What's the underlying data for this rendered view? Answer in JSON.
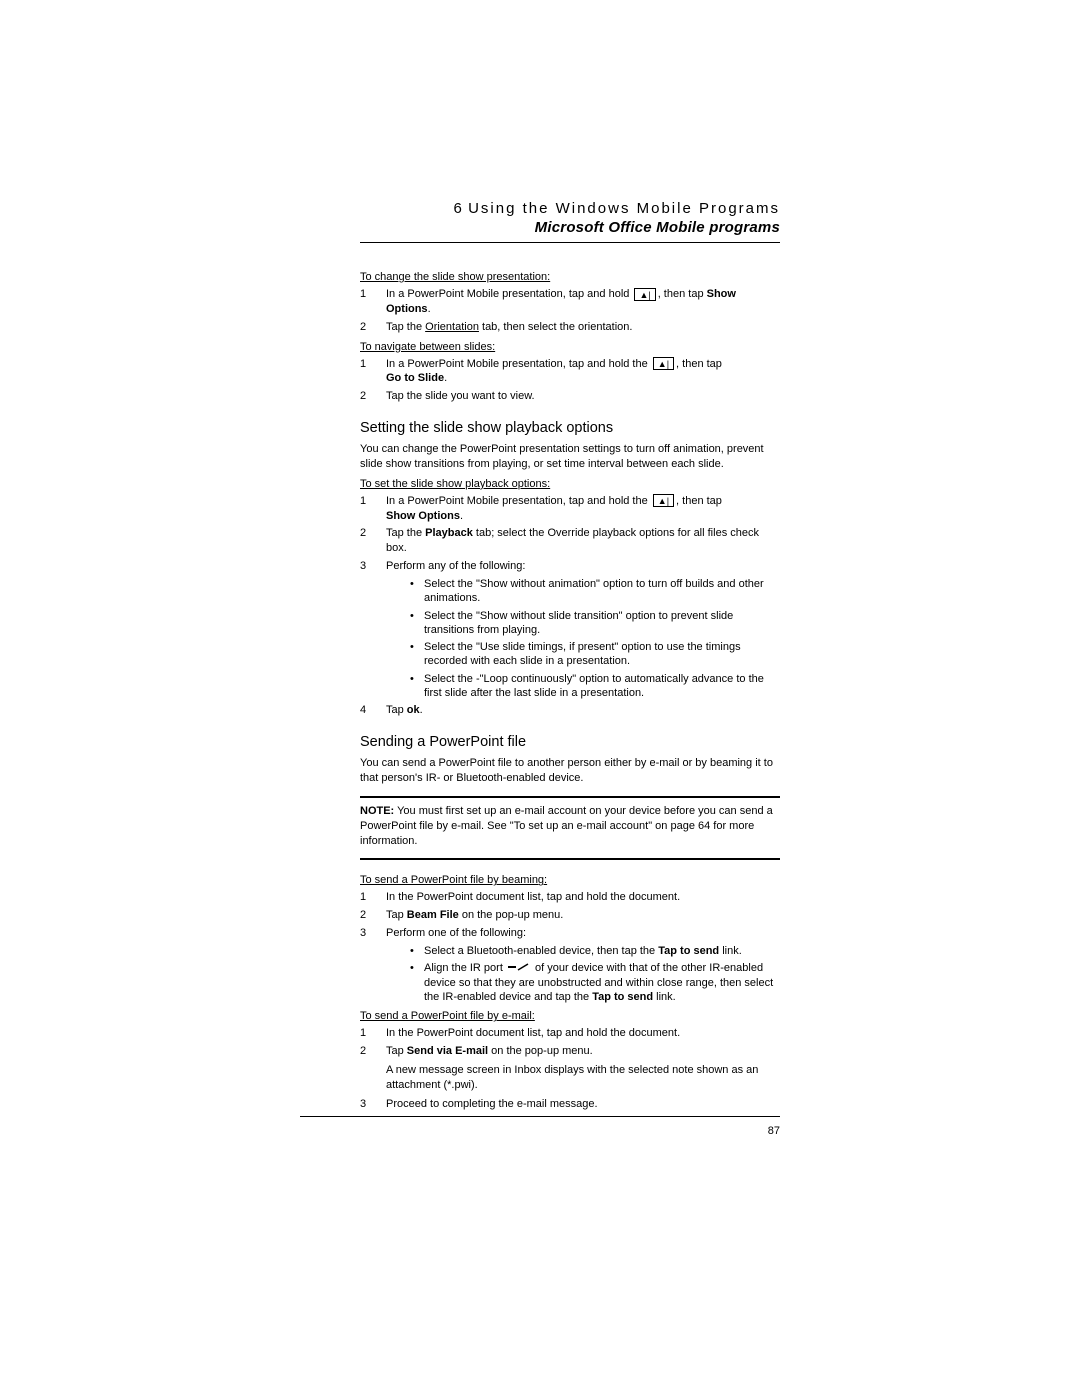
{
  "header": {
    "chapter_num": "6",
    "chapter_title": "Using the Windows Mobile Programs",
    "subtitle": "Microsoft Office Mobile programs"
  },
  "page_number": "87",
  "sec1": {
    "title": "To change the slide show presentation:",
    "step1_a": "In a PowerPoint Mobile presentation, tap and hold ",
    "step1_b": ", then tap ",
    "step1_bold": "Show Options",
    "step1_c": ".",
    "step2_a": "Tap the ",
    "step2_link": "Orientation",
    "step2_b": " tab, then select the orientation."
  },
  "sec2": {
    "title": "To navigate between slides:",
    "step1_a": "In a PowerPoint Mobile presentation, tap and hold the ",
    "step1_b": ", then tap ",
    "step1_bold": "Go to Slide",
    "step1_c": ".",
    "step2": "Tap the slide you want to view."
  },
  "sec3": {
    "heading": "Setting the slide show playback options",
    "intro": "You can change the PowerPoint presentation settings to turn off animation, prevent slide show transitions from playing, or set time interval between each slide.",
    "subtitle": "To set the slide show playback options:",
    "step1_a": "In a PowerPoint Mobile presentation, tap and hold the ",
    "step1_b": ", then tap ",
    "step1_bold": "Show Options",
    "step1_c": ".",
    "step2_a": "Tap the ",
    "step2_bold": "Playback",
    "step2_b": " tab; select the Override playback options for all files check box.",
    "step3": "Perform any of the following:",
    "b1": "Select the \"Show without animation\" option to turn off builds and other animations.",
    "b2": "Select the \"Show without slide transition\" option to prevent slide transitions from playing.",
    "b3": "Select the \"Use slide timings, if present\" option to use the timings recorded with each slide in a presentation.",
    "b4": "Select the -\"Loop continuously\" option to automatically advance to the first slide after the last slide in a presentation.",
    "step4_a": "Tap ",
    "step4_bold": "ok",
    "step4_b": "."
  },
  "sec4": {
    "heading": "Sending a PowerPoint file",
    "intro": "You can send a PowerPoint file to another person either by e-mail or by beaming it to that person's IR- or Bluetooth-enabled device.",
    "note_label": "NOTE:",
    "note_text": "   You must first set up an e-mail account on your device before you can send a PowerPoint file by e-mail. See \"To set up an e-mail account\" on page 64 for more information."
  },
  "sec5": {
    "title": "To send a PowerPoint file by beaming:",
    "step1": "In the PowerPoint document list, tap and hold the document.",
    "step2_a": "Tap ",
    "step2_bold": "Beam File",
    "step2_b": " on the pop-up menu.",
    "step3": "Perform one of the following:",
    "b1_a": "Select a Bluetooth-enabled device, then tap the ",
    "b1_bold": "Tap to send",
    "b1_b": " link.",
    "b2_a": "Align the IR port ",
    "b2_b": " of your device with that of the other IR-enabled device so that they are unobstructed and within close range, then select the IR-enabled device and tap the ",
    "b2_bold": "Tap to send",
    "b2_c": " link."
  },
  "sec6": {
    "title": "To send a PowerPoint file by e-mail:",
    "step1": "In the PowerPoint document list, tap and hold the document.",
    "step2_a": "Tap ",
    "step2_bold": "Send via E-mail",
    "step2_b": " on the pop-up menu.",
    "step2_extra": "A new message screen in Inbox displays with the selected note shown as an attachment (*.pwi).",
    "step3": "Proceed to completing the e-mail message."
  }
}
